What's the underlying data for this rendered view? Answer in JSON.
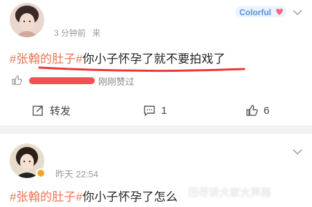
{
  "post1": {
    "meta_time": "3 分钟前",
    "meta_source": "来",
    "badge_word": "Colorful",
    "topic": "#张翰的肚子#",
    "content": "你小子怀孕了就不要拍戏了",
    "liked_by": "刚刚赞过",
    "actions": {
      "forward_label": "转发",
      "comment_count": "1",
      "like_count": "6"
    }
  },
  "post2": {
    "meta_time": "昨天 22:54",
    "topic": "#张翰的肚子#",
    "content": "你小子怀孕了怎么",
    "watermark": "历尽讲大家大声路"
  },
  "colors": {
    "topic": "#eb7350",
    "redaction": "#e33333",
    "separator": "#f2f2f2"
  }
}
